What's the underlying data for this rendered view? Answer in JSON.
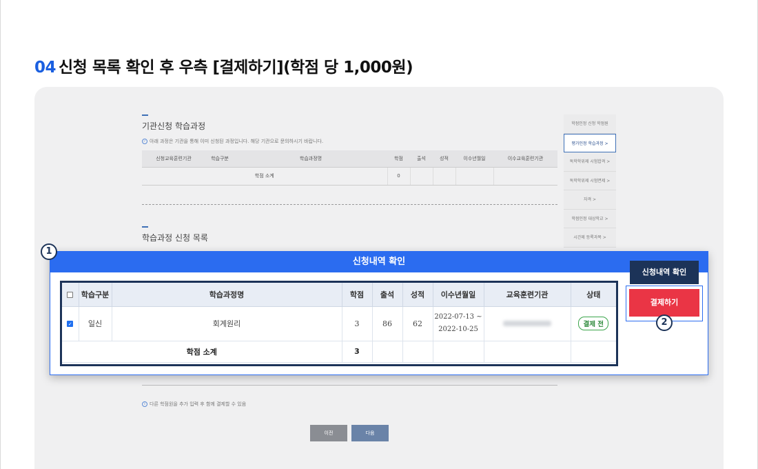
{
  "heading": {
    "step": "04",
    "text": "신청 목록 확인 후 우측 [결제하기](학점 당 1,000원)"
  },
  "background": {
    "section1_title": "기관신청 학습과정",
    "section1_note": "아래 과정은 기관을 통해 이미 신청된 과정입니다. 해당 기관으로 문의하시기 바랍니다.",
    "section1_columns": [
      "신청교육훈련기관",
      "학습구분",
      "학습과정명",
      "학점",
      "출석",
      "성적",
      "이수년월일",
      "이수교육훈련기관"
    ],
    "section1_subtotal_label": "학점 소계",
    "section1_subtotal_value": "0",
    "section2_title": "학습과정 신청 목록",
    "side_nav": [
      "학점인정 신청 학점원",
      "평가인정 학습과정 >",
      "독학학위제 시험합격 >",
      "독학학위제 시험면제 >",
      "자격 >",
      "학점인정 대상학교 >",
      "시간제 등록과목 >"
    ],
    "lower_note": "다른 학점원을 추가 입력 후 함께 결제할 수 있음",
    "prev_label": "이전",
    "next_label": "다음"
  },
  "modal": {
    "title": "신청내역 확인",
    "columns": [
      "학습구분",
      "학습과정명",
      "학점",
      "출석",
      "성적",
      "이수년월일",
      "교육훈련기관",
      "상태"
    ],
    "rows": [
      {
        "checked": true,
        "type": "일신",
        "course": "회계원리",
        "credit": "3",
        "attendance": "86",
        "grade": "62",
        "date_from": "2022-07-13 ~",
        "date_to": "2022-10-25",
        "status": "결제 전"
      }
    ],
    "subtotal_label": "학점 소계",
    "subtotal_value": "3"
  },
  "buttons": {
    "confirm": "신청내역 확인",
    "pay": "결제하기"
  },
  "markers": {
    "m1": "1",
    "m2": "2"
  },
  "colors": {
    "accent": "#2b6cf0",
    "navy": "#1c3358",
    "pay": "#ea3545",
    "status_green": "#3aa44a"
  }
}
